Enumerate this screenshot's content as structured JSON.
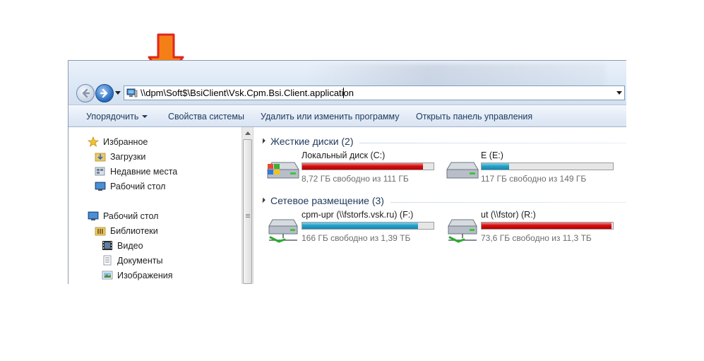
{
  "address": {
    "path": "\\\\dpm\\Soft$\\BsiClient\\Vsk.Cpm.Bsi.Client.application"
  },
  "toolbar": {
    "organize": "Упорядочить",
    "system_properties": "Свойства системы",
    "uninstall": "Удалить или изменить программу",
    "control_panel": "Открыть панель управления"
  },
  "navigation": {
    "favorites": {
      "label": "Избранное",
      "items": [
        {
          "label": "Загрузки",
          "icon": "downloads-folder-icon"
        },
        {
          "label": "Недавние места",
          "icon": "recent-places-icon"
        },
        {
          "label": "Рабочий стол",
          "icon": "desktop-icon"
        }
      ]
    },
    "desktop": {
      "label": "Рабочий стол",
      "libraries": {
        "label": "Библиотеки",
        "items": [
          {
            "label": "Видео",
            "icon": "video-icon"
          },
          {
            "label": "Документы",
            "icon": "documents-icon"
          },
          {
            "label": "Изображения",
            "icon": "pictures-icon"
          }
        ]
      }
    }
  },
  "content": {
    "hard_drives": {
      "title": "Жесткие диски (2)",
      "drives": [
        {
          "name": "Локальный диск (C:)",
          "free": "8,72 ГБ свободно из 111 ГБ",
          "used_fraction": 0.92,
          "bar_color": "red"
        },
        {
          "name": "E (E:)",
          "free": "117 ГБ свободно из 149 ГБ",
          "used_fraction": 0.21,
          "bar_color": "blue"
        }
      ]
    },
    "network": {
      "title": "Сетевое размещение (3)",
      "drives": [
        {
          "name": "cpm-upr (\\\\fstorfs.vsk.ru) (F:)",
          "free": "166 ГБ свободно из 1,39 ТБ",
          "used_fraction": 0.88,
          "bar_color": "blue"
        },
        {
          "name": "ut (\\\\fstor) (R:)",
          "free": "73,6 ГБ свободно из 11,3 ТБ",
          "used_fraction": 0.99,
          "bar_color": "red"
        }
      ]
    }
  },
  "colors": {
    "arrow": "#f57f17",
    "arrow_outline": "#e1261c",
    "bar_red": "#d40f0f",
    "bar_blue": "#26a1c9"
  }
}
